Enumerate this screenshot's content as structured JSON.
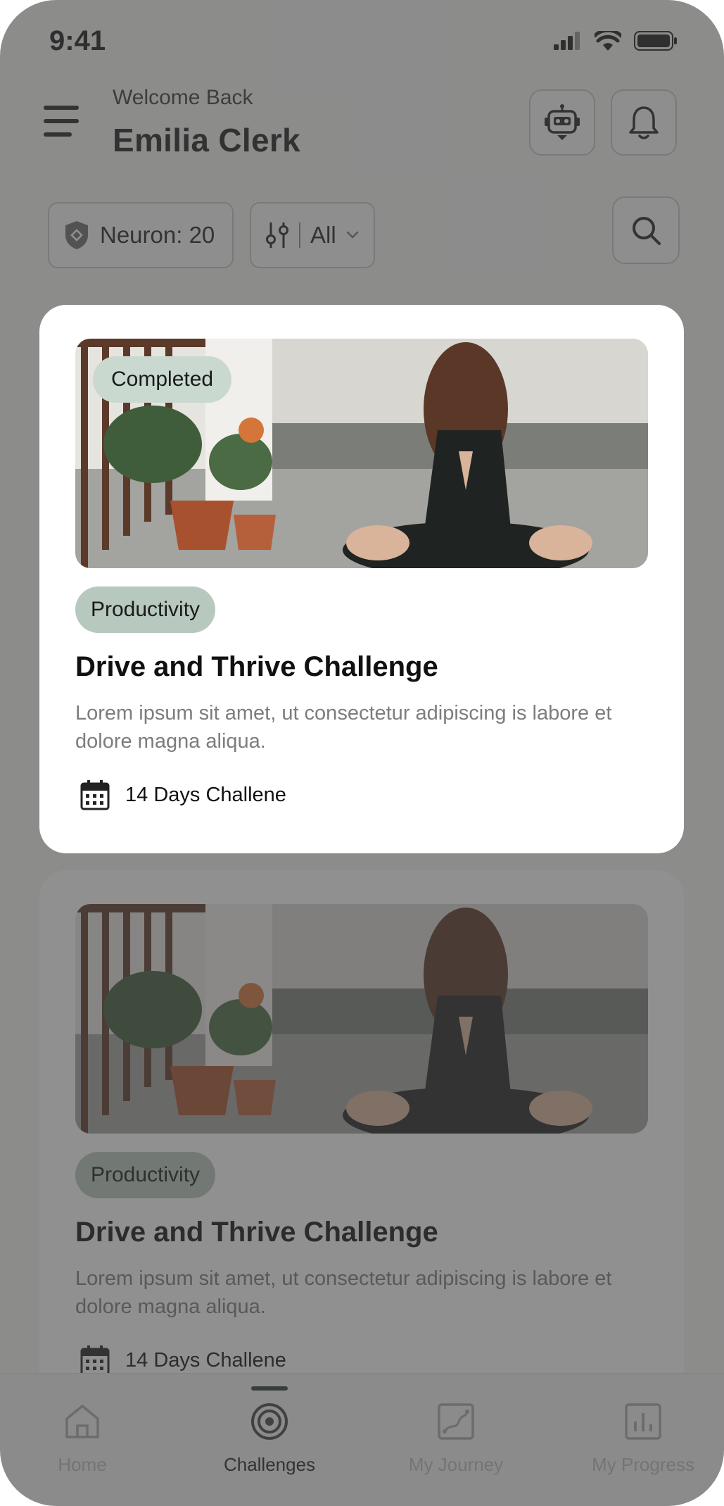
{
  "status_bar": {
    "time": "9:41"
  },
  "header": {
    "welcome": "Welcome Back",
    "user_name": "Emilia Clerk",
    "bot_icon": "robot-icon",
    "notification_icon": "bell-icon"
  },
  "filters": {
    "neuron_label": "Neuron: 20",
    "filter_value": "All",
    "search_icon": "search-icon"
  },
  "cards": [
    {
      "status": "Completed",
      "category": "Productivity",
      "title": "Drive and Thrive Challenge",
      "description": "Lorem ipsum sit amet, ut consectetur adipiscing is  labore et dolore magna aliqua.",
      "duration": "14 Days Challene"
    },
    {
      "category": "Productivity",
      "title": "Drive and Thrive Challenge",
      "description": "Lorem ipsum sit amet, ut consectetur adipiscing is  labore et dolore magna aliqua.",
      "duration": "14 Days Challene"
    }
  ],
  "bottom_nav": {
    "items": [
      {
        "label": "Home",
        "icon": "home-icon"
      },
      {
        "label": "Challenges",
        "icon": "target-icon",
        "active": true
      },
      {
        "label": "My Journey",
        "icon": "journey-icon"
      },
      {
        "label": "My Progress",
        "icon": "chart-icon"
      }
    ]
  },
  "colors": {
    "accent": "#b7c8bf",
    "completed_chip": "#c9d9d0",
    "overlay": "#404040"
  }
}
